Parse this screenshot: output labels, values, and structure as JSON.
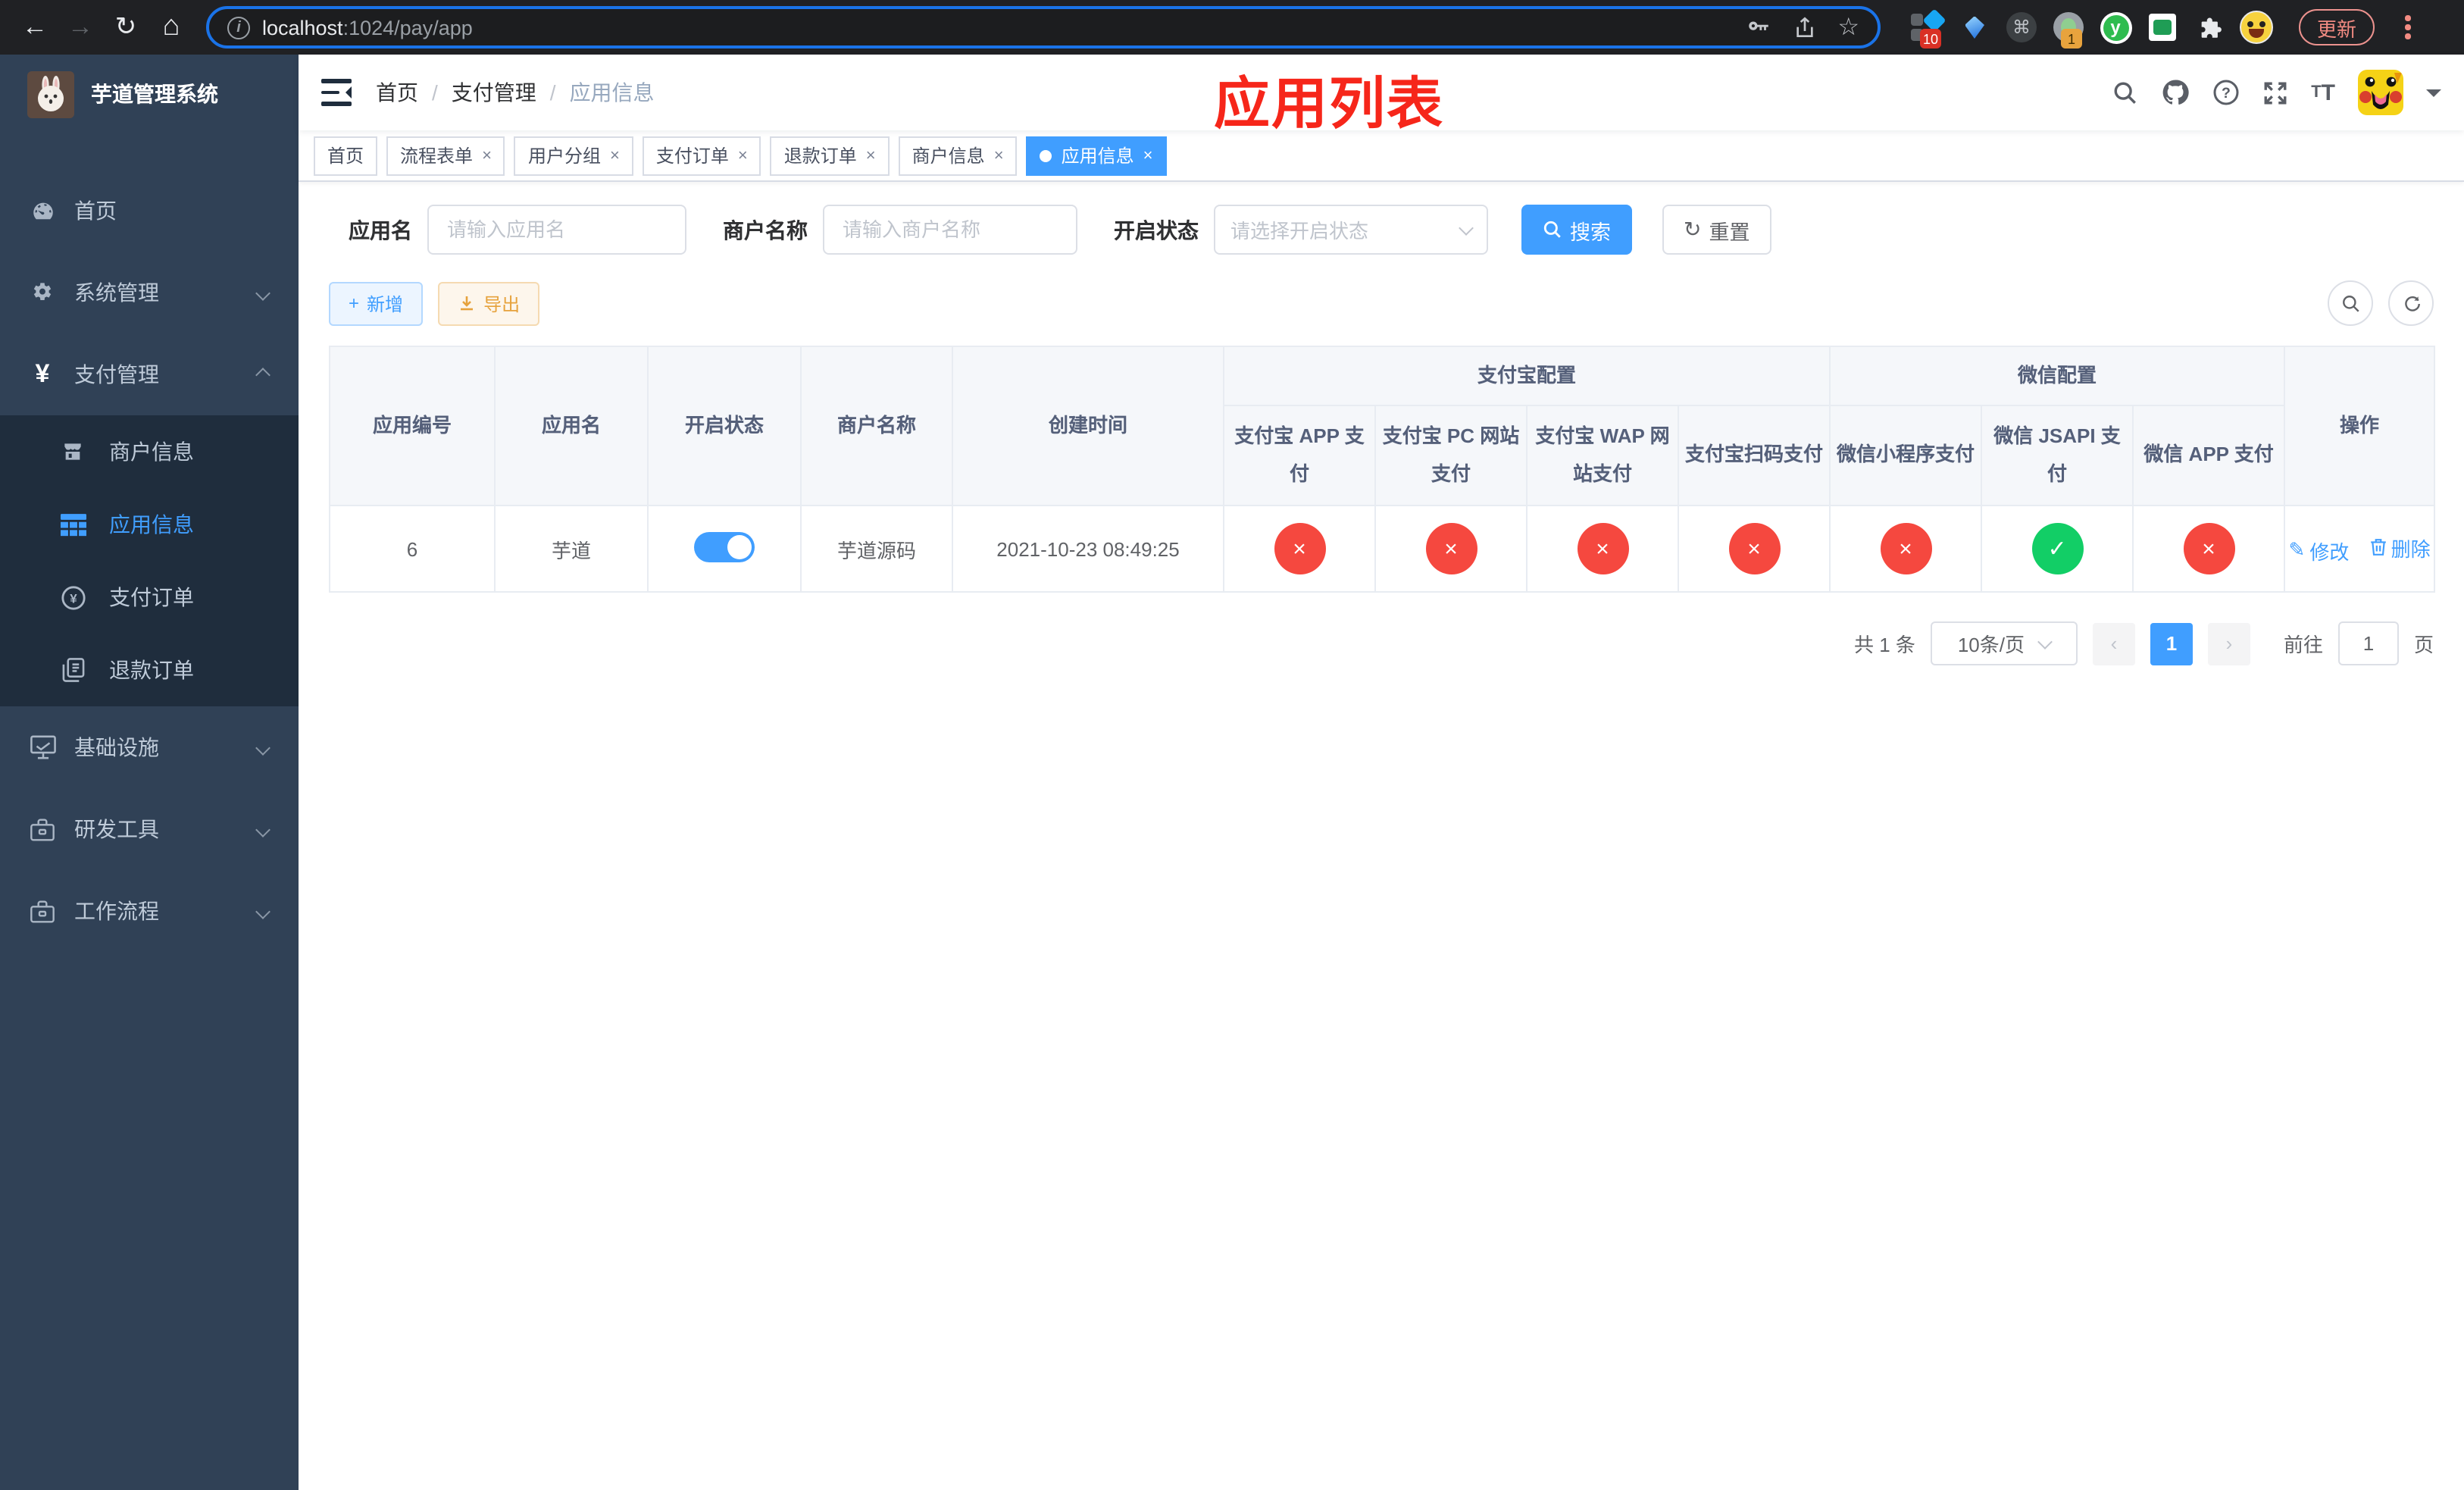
{
  "colors": {
    "accent": "#409EFF",
    "success": "#12ce66",
    "danger": "#f5483f",
    "warning": "#E6A23C",
    "sidebar_bg": "#304156",
    "submenu_bg": "#1f2d3d",
    "annotation_red": "#f6261a"
  },
  "browser": {
    "url_host": "localhost",
    "url_rest": ":1024/pay/app",
    "ext_badge_a": "10",
    "ext_badge_b": "1",
    "ext_y": "y",
    "update_label": "更新"
  },
  "sidebar": {
    "title": "芋道管理系统",
    "items": [
      {
        "label": "首页"
      },
      {
        "label": "系统管理"
      },
      {
        "label": "支付管理",
        "children": [
          {
            "label": "商户信息"
          },
          {
            "label": "应用信息",
            "active": true
          },
          {
            "label": "支付订单"
          },
          {
            "label": "退款订单"
          }
        ]
      },
      {
        "label": "基础设施"
      },
      {
        "label": "研发工具"
      },
      {
        "label": "工作流程"
      }
    ]
  },
  "header": {
    "breadcrumb": [
      "首页",
      "支付管理",
      "应用信息"
    ],
    "annotation": "应用列表"
  },
  "tabs": {
    "items": [
      {
        "label": "首页",
        "closable": false
      },
      {
        "label": "流程表单",
        "closable": true
      },
      {
        "label": "用户分组",
        "closable": true
      },
      {
        "label": "支付订单",
        "closable": true
      },
      {
        "label": "退款订单",
        "closable": true
      },
      {
        "label": "商户信息",
        "closable": true
      },
      {
        "label": "应用信息",
        "closable": true,
        "active": true
      }
    ]
  },
  "filters": {
    "app_name": {
      "label": "应用名",
      "placeholder": "请输入应用名"
    },
    "merchant": {
      "label": "商户名称",
      "placeholder": "请输入商户名称"
    },
    "status": {
      "label": "开启状态",
      "placeholder": "请选择开启状态"
    },
    "search_label": "搜索",
    "reset_label": "重置"
  },
  "toolbar": {
    "add_label": "新增",
    "export_label": "导出"
  },
  "table": {
    "groups": [
      "支付宝配置",
      "微信配置"
    ],
    "columns": [
      "应用编号",
      "应用名",
      "开启状态",
      "商户名称",
      "创建时间",
      "支付宝 APP 支付",
      "支付宝 PC 网站支付",
      "支付宝 WAP 网站支付",
      "支付宝扫码支付",
      "微信小程序支付",
      "微信 JSAPI 支付",
      "微信 APP 支付",
      "操作"
    ],
    "row": {
      "id": "6",
      "name": "芋道",
      "enabled": true,
      "merchant": "芋道源码",
      "created_at": "2021-10-23 08:49:25",
      "statuses": [
        "fail",
        "fail",
        "fail",
        "fail",
        "fail",
        "success",
        "fail"
      ],
      "edit_label": "修改",
      "delete_label": "删除"
    }
  },
  "pagination": {
    "total": "共 1 条",
    "page_size": "10条/页",
    "page": "1",
    "goto_prefix": "前往",
    "goto_value": "1",
    "goto_suffix": "页"
  }
}
